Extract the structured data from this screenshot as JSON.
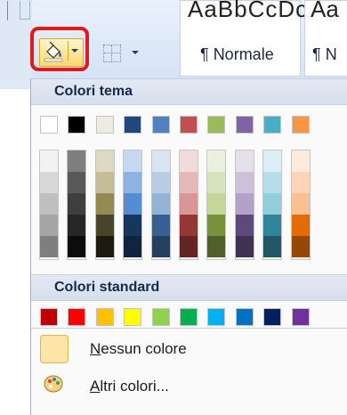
{
  "ribbon": {
    "style_preview_text": "AaBbCcDc",
    "style_preview_text_next": "Aa",
    "style_normale": "Normale",
    "style_next_label": "N",
    "paragraph_mark": "¶"
  },
  "menu": {
    "theme_header": "Colori tema",
    "standard_header": "Colori standard",
    "no_color_prefix": "N",
    "no_color_rest": "essun colore",
    "more_colors_prefix": "A",
    "more_colors_rest": "ltri colori..."
  },
  "theme_colors": [
    {
      "base": "#ffffff",
      "shades": [
        "#f2f2f2",
        "#d8d8d8",
        "#bfbfbf",
        "#a5a5a5",
        "#7f7f7f"
      ]
    },
    {
      "base": "#000000",
      "shades": [
        "#7f7f7f",
        "#595959",
        "#3f3f3f",
        "#262626",
        "#0c0c0c"
      ]
    },
    {
      "base": "#eeece1",
      "shades": [
        "#ddd9c3",
        "#c4bd97",
        "#938953",
        "#494429",
        "#1d1b10"
      ]
    },
    {
      "base": "#1f497d",
      "shades": [
        "#c6d9f0",
        "#8db3e2",
        "#548dd4",
        "#17365d",
        "#0f243e"
      ]
    },
    {
      "base": "#4f81bd",
      "shades": [
        "#dbe5f1",
        "#b8cce4",
        "#95b3d7",
        "#366092",
        "#244061"
      ]
    },
    {
      "base": "#c0504d",
      "shades": [
        "#f2dcdb",
        "#e5b9b7",
        "#d99694",
        "#953734",
        "#632423"
      ]
    },
    {
      "base": "#9bbb59",
      "shades": [
        "#ebf1dd",
        "#d7e3bc",
        "#c3d69b",
        "#76923c",
        "#4f6128"
      ]
    },
    {
      "base": "#8064a2",
      "shades": [
        "#e5e0ec",
        "#ccc1d9",
        "#b2a2c7",
        "#5f497a",
        "#3f3151"
      ]
    },
    {
      "base": "#4bacc6",
      "shades": [
        "#dbeef3",
        "#b7dde8",
        "#92cddc",
        "#31859b",
        "#205867"
      ]
    },
    {
      "base": "#f79646",
      "shades": [
        "#fdeada",
        "#fbd5b5",
        "#fac08f",
        "#e36c09",
        "#974806"
      ]
    }
  ],
  "standard_colors": [
    "#c00000",
    "#ff0000",
    "#ffc000",
    "#ffff00",
    "#92d050",
    "#00b050",
    "#00b0f0",
    "#0070c0",
    "#002060",
    "#7030a0"
  ],
  "colors": {
    "highlight_border": "#e11b1b",
    "no_color_fill": "#fde5a6"
  }
}
